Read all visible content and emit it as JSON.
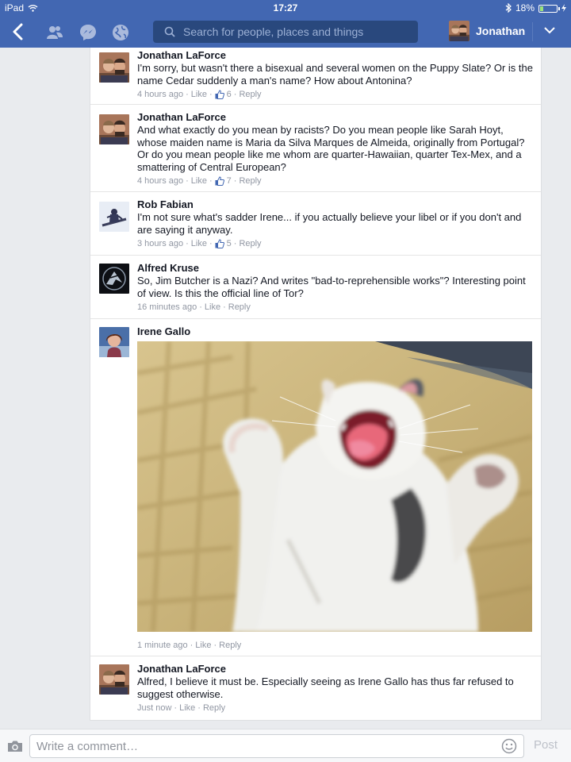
{
  "status_bar": {
    "device": "iPad",
    "time": "17:27",
    "battery_text": "18%",
    "battery_level": 0.18
  },
  "nav": {
    "back_icon": "chevron-left-icon",
    "search_placeholder": "Search for people, places and things",
    "user_name": "Jonathan"
  },
  "comments": [
    {
      "author": "Jonathan LaForce",
      "text": "I'm sorry, but wasn't there a bisexual and several women on the Puppy Slate? Or is the name Cedar suddenly a man's name? How about Antonina?",
      "time": "4 hours ago",
      "like": "Like",
      "likes": "6",
      "reply": "Reply"
    },
    {
      "author": "Jonathan LaForce",
      "text": "And what exactly do you mean by racists? Do you mean people like Sarah Hoyt, whose maiden name is Maria da Silva Marques de Almeida, originally from Portugal? Or do you mean people like me whom are quarter-Hawaiian, quarter Tex-Mex, and a smattering of Central European?",
      "time": "4 hours ago",
      "like": "Like",
      "likes": "7",
      "reply": "Reply"
    },
    {
      "author": "Rob Fabian",
      "text": "I'm not sure what's sadder Irene... if you actually believe your libel or if you don't and are saying it anyway.",
      "time": "3 hours ago",
      "like": "Like",
      "likes": "5",
      "reply": "Reply"
    },
    {
      "author": "Alfred Kruse",
      "text": "So, Jim Butcher is a Nazi? And writes \"bad-to-reprehensible works\"? Interesting point of view. Is this the official line of Tor?",
      "time": "16 minutes ago",
      "like": "Like",
      "reply": "Reply"
    },
    {
      "author": "Irene Gallo",
      "time": "1 minute ago",
      "like": "Like",
      "reply": "Reply"
    },
    {
      "author": "Jonathan LaForce",
      "text": "Alfred, I believe it must be. Especially seeing as Irene Gallo has thus far refused to suggest otherwise.",
      "time": "Just now",
      "like": "Like",
      "reply": "Reply"
    }
  ],
  "composer": {
    "placeholder": "Write a comment…",
    "post_label": "Post"
  },
  "colors": {
    "nav_blue": "#4267b2",
    "search_bg": "#29487d",
    "link_blue": "#4267b2",
    "meta_gray": "#9197a3"
  }
}
